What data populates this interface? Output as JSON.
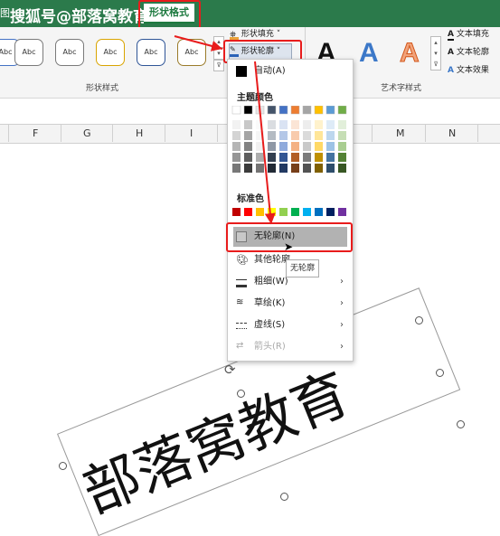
{
  "titlebar": {
    "left_tab_fragment": "图",
    "watermark": "搜狐号@部落窝教育",
    "active_tab": "形状格式"
  },
  "ribbon": {
    "style_samples": [
      "Abc",
      "Abc",
      "Abc",
      "Abc",
      "Abc"
    ],
    "shape_styles_label": "形状样式",
    "shape_fill_label": "形状填充",
    "shape_outline_label": "形状轮廓",
    "wordart_letters": [
      "A",
      "A",
      "A"
    ],
    "text_fill_label": "文本填充",
    "text_outline_label": "文本轮廓",
    "text_effect_label": "文本效果",
    "wordart_styles_label": "艺术字样式",
    "scroll_up": "▴",
    "scroll_down": "▾",
    "scroll_more": "⊽"
  },
  "columns": [
    "F",
    "G",
    "H",
    "I",
    "M",
    "N"
  ],
  "menu": {
    "auto_label": "自动(A)",
    "theme_colors_label": "主题颜色",
    "standard_colors_label": "标准色",
    "no_outline_label": "无轮廓(N)",
    "more_colors_label": "其他轮廓…",
    "weight_label": "粗细(W)",
    "sketch_label": "草绘(K)",
    "dashes_label": "虚线(S)",
    "arrows_label": "箭头(R)",
    "submenu_arrow": "›"
  },
  "tooltip": "无轮廓",
  "shape_text": "部落窝教育",
  "theme_colors_top": [
    "#ffffff",
    "#000000",
    "#e7e6e6",
    "#44546a",
    "#4472c4",
    "#ed7d31",
    "#a5a5a5",
    "#ffc000",
    "#5b9bd5",
    "#70ad47"
  ],
  "standard_colors": [
    "#c00000",
    "#ff0000",
    "#ffc000",
    "#ffff00",
    "#92d050",
    "#00b050",
    "#00b0f0",
    "#0070c0",
    "#002060",
    "#7030a0"
  ],
  "accent_red": "#e81c1c"
}
